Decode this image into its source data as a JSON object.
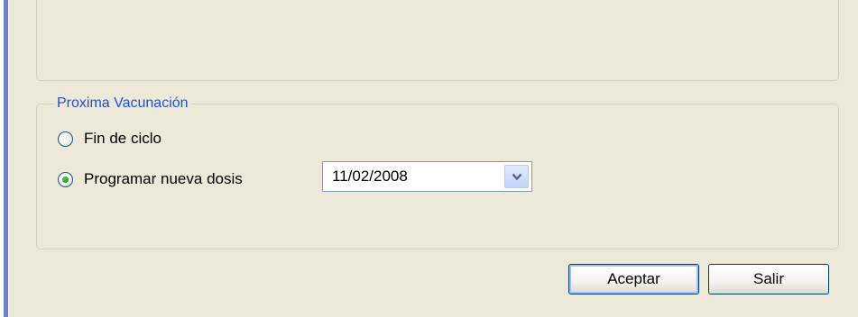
{
  "proxima_vacunacion": {
    "legend": "Proxima Vacunación",
    "options": [
      {
        "label": "Fin de ciclo",
        "selected": false
      },
      {
        "label": "Programar nueva dosis",
        "selected": true
      }
    ],
    "date": {
      "value": "11/02/2008"
    }
  },
  "buttons": {
    "accept_label": "Aceptar",
    "exit_label": "Salir"
  },
  "colors": {
    "dialog_background": "#ece9d8",
    "legend_text": "#2150d4",
    "window_frame": "#6f7fd6",
    "radio_selected": "#21a121"
  },
  "icons": {
    "dropdown": "chevron-down-icon"
  }
}
